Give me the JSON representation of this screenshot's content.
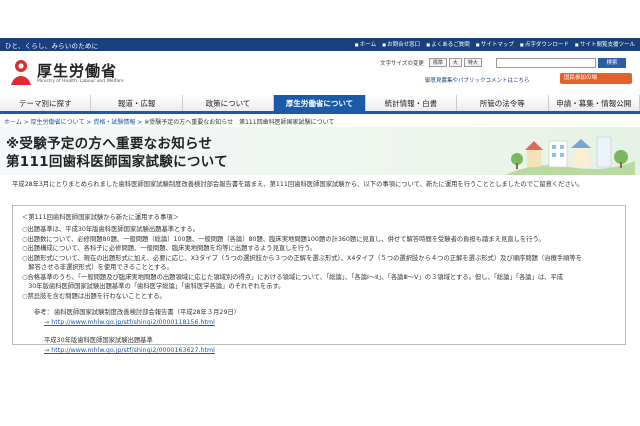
{
  "topbar": {
    "tagline": "ひと、くらし、みらいのために",
    "links": [
      "ホーム",
      "お問合せ窓口",
      "よくあるご質問",
      "サイトマップ",
      "点字ダウンロード",
      "サイト閲覧支援ツール"
    ]
  },
  "header": {
    "logo_title": "厚生労働省",
    "logo_sub": "Ministry of Health, Labour and Welfare",
    "font_size_label": "文字サイズの変更",
    "font_sizes": [
      "標準",
      "大",
      "特大"
    ],
    "search_placeholder": "",
    "search_button": "検索",
    "opinion_link": "御意見募集やパブリックコメントはこちら",
    "kokumin_button": "国民参加の場"
  },
  "nav": {
    "tabs": [
      "テーマ別に探す",
      "報道・広報",
      "政策について",
      "厚生労働省について",
      "統計情報・白書",
      "所管の法令等",
      "申請・募集・情報公開"
    ],
    "active_index": 3
  },
  "breadcrumb": {
    "items": [
      "ホーム",
      "厚生労働省について",
      "資格・試験情報"
    ],
    "current": "※受験予定の方へ重要なお知らせ　第111回歯科医師国家試験について"
  },
  "page": {
    "title_line1": "※受験予定の方へ重要なお知らせ",
    "title_line2": "第111回歯科医師国家試験について",
    "intro": "平成28年3月にとりまとめられました歯科医師国家試験制度改善検討部会報告書を踏まえ、第111回歯科医師国家試験から、以下の事項について、新たに運用を行うこととしましたのでご留意ください。"
  },
  "box": {
    "heading": "＜第111回歯科医師国家試験から新たに運用する事項＞",
    "items": [
      "○出題基準は、平成30年版歯科医師国家試験出題基準とする。",
      "○出題数について、必修問題80題、一般問題（総論）100題、一般問題（各論）80題、臨床実地問題100題の計360題に見直し、併せて解答時間を受験者の負担も踏まえ見直しを行う。",
      "○出題構成について、各科子に必修問題、一般問題、臨床実地問題を均等に出題するよう見直しを行う。",
      "○出題形式について、現在の出題形式に加え、必要に応じ、X3タイプ（５つの選択肢から３つの正解を選ぶ形式）、X4タイプ（５つの選択肢から４つの正解を選ぶ形式）及び順序問題（治療手順等を",
      "　解答させる非選択形式）を使用できることとする。",
      "○合格基準のうち、「一般問題及び臨床実地問題の出題領域に応じた領域別の得点」における領域について、「総論」、「各論Ⅰ〜Ⅱ」、「各論Ⅲ〜Ⅴ」の３領域とする。但し、「総論」「各論」は、平成",
      "　30年版歯科医師国家試験出題基準の「歯科医学総論」「歯科医学各論」のそれぞれを示す。",
      "○禁忌肢を含む問題は出題を行わないこととする。"
    ]
  },
  "references": {
    "label": "参考：",
    "ref1_title": "歯科医師国家試験制度改善検討部会報告書（平成28年３月29日）",
    "ref1_url": "http://www.mhlw.go.jp/stf/shingi2/0000118156.html",
    "ref2_title": "平成30年版歯科医師国家試験出題基準",
    "ref2_url": "http://www.mhlw.go.jp/stf/shingi2/0000163627.html"
  },
  "colors": {
    "topbar": "#1a3f7a",
    "nav_active": "#1a5aa6",
    "link": "#1a5aa6",
    "kokumin": "#e3622a"
  }
}
